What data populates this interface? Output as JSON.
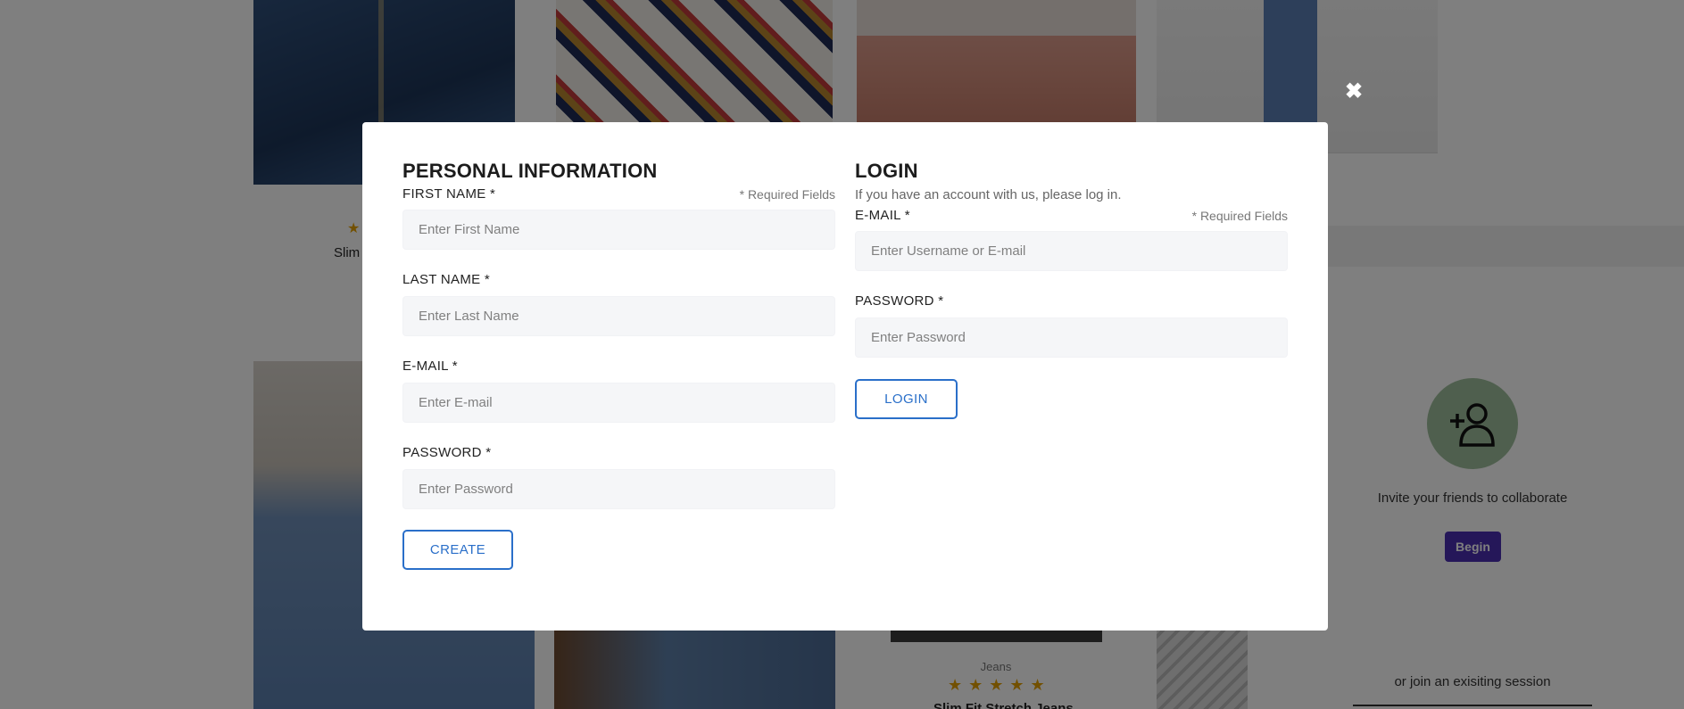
{
  "background": {
    "top_left_product": {
      "stars": "★",
      "name": "Slim"
    },
    "bottom_product": {
      "category": "Jeans",
      "stars": "★★★★★",
      "name": "Slim Fit Stretch Jeans"
    },
    "invite": {
      "text": "Invite your friends to collaborate",
      "begin_label": "Begin",
      "join_text": "or join an exisiting session"
    }
  },
  "modal": {
    "close_icon": "close-icon",
    "personal": {
      "title": "PERSONAL INFORMATION",
      "required_note": "* Required Fields",
      "first_name": {
        "label": "FIRST NAME *",
        "placeholder": "Enter First Name",
        "value": ""
      },
      "last_name": {
        "label": "LAST NAME *",
        "placeholder": "Enter Last Name",
        "value": ""
      },
      "email": {
        "label": "E-MAIL *",
        "placeholder": "Enter E-mail",
        "value": ""
      },
      "password": {
        "label": "PASSWORD *",
        "placeholder": "Enter Password",
        "value": ""
      },
      "create_label": "CREATE"
    },
    "login": {
      "title": "LOGIN",
      "subtitle": "If you have an account with us, please log in.",
      "required_note": "* Required Fields",
      "email": {
        "label": "E-MAIL *",
        "placeholder": "Enter Username or E-mail",
        "value": ""
      },
      "password": {
        "label": "PASSWORD *",
        "placeholder": "Enter Password",
        "value": ""
      },
      "login_label": "LOGIN"
    }
  },
  "colors": {
    "accent": "#2a6fc9",
    "begin_button": "#4b2fb3",
    "avatar_bg": "#9fbf9c",
    "input_bg": "#f5f6f8"
  }
}
